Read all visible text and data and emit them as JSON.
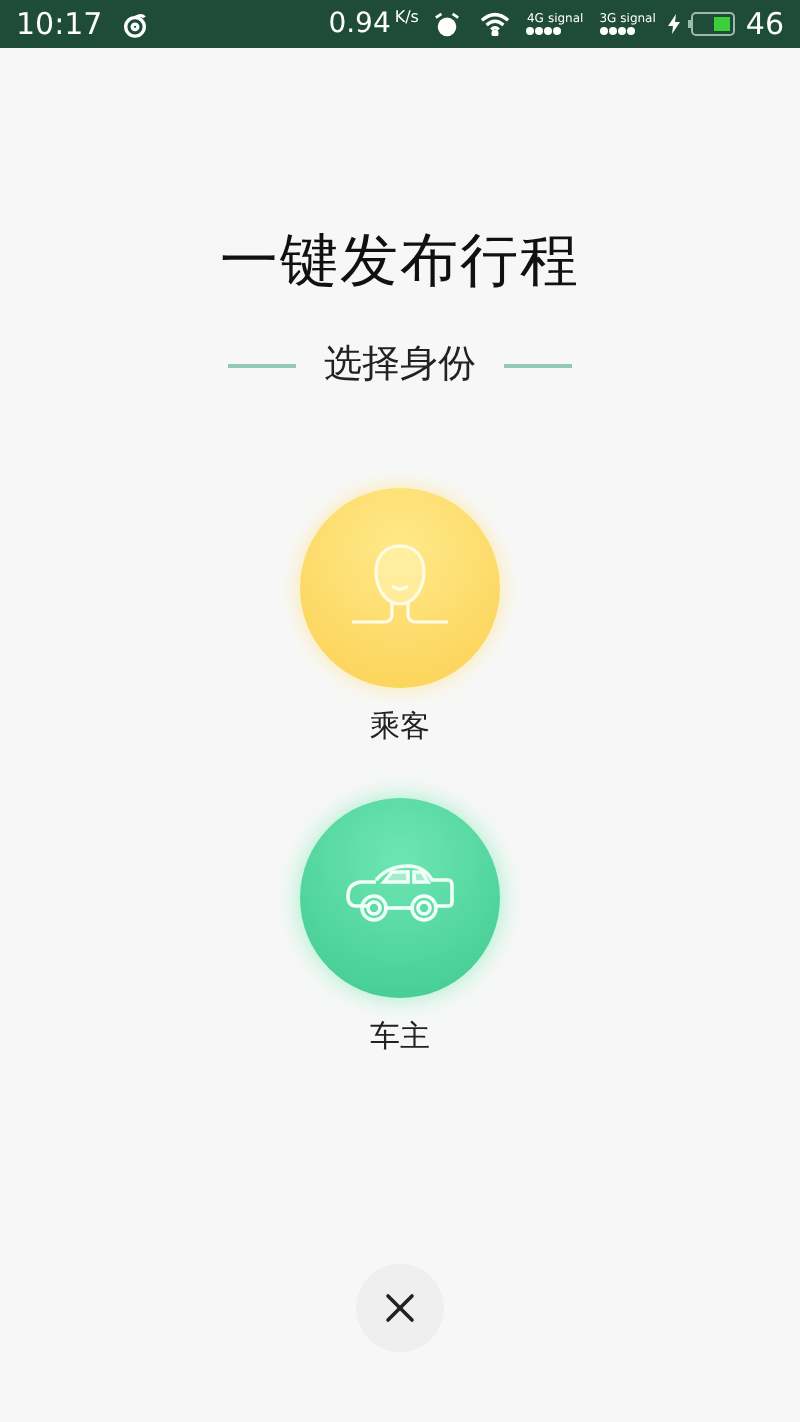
{
  "status_bar": {
    "time": "10:17",
    "speed": "0.94",
    "speed_unit": "K/s",
    "networks": [
      {
        "label": "4G",
        "sub": "signal"
      },
      {
        "label": "3G",
        "sub": "signal"
      }
    ],
    "battery": "46"
  },
  "title": "一键发布行程",
  "subtitle": "选择身份",
  "roles": [
    {
      "kind": "passenger",
      "label": "乘客"
    },
    {
      "kind": "driver",
      "label": "车主"
    }
  ]
}
